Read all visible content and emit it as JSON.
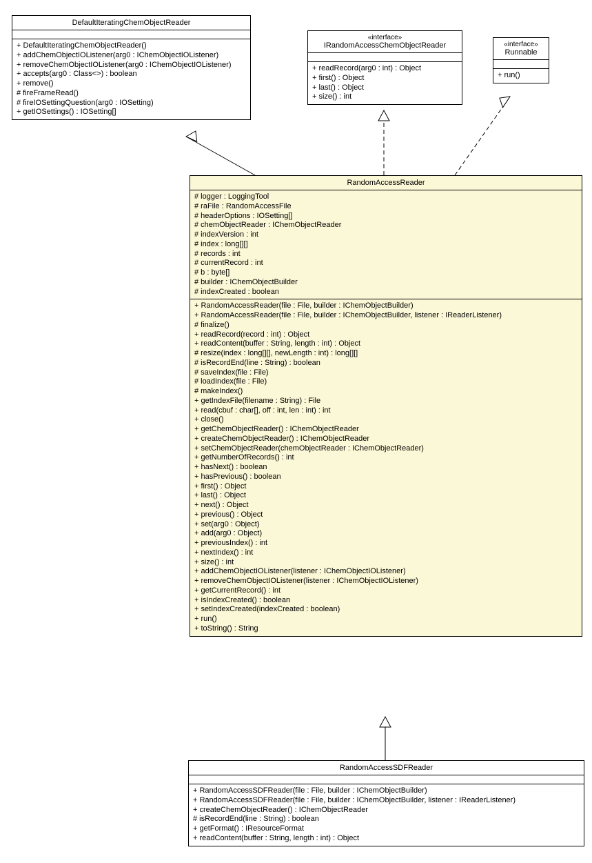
{
  "classes": {
    "dicor": {
      "name": "DefaultIteratingChemObjectReader",
      "methods": [
        "+ DefaultIteratingChemObjectReader()",
        "+ addChemObjectIOListener(arg0 : IChemObjectIOListener)",
        "+ removeChemObjectIOListener(arg0 : IChemObjectIOListener)",
        "+ accepts(arg0 : Class<>) : boolean",
        "+ remove()",
        "# fireFrameRead()",
        "# fireIOSettingQuestion(arg0 : IOSetting)",
        "+ getIOSettings() : IOSetting[]"
      ]
    },
    "iracor": {
      "stereo": "«interface»",
      "name": "IRandomAccessChemObjectReader",
      "methods": [
        "+ readRecord(arg0 : int) : Object",
        "+ first() : Object",
        "+ last() : Object",
        "+ size() : int"
      ]
    },
    "runnable": {
      "stereo": "«interface»",
      "name": "Runnable",
      "methods": [
        "+ run()"
      ]
    },
    "rar": {
      "name": "RandomAccessReader",
      "attrs": [
        "# logger : LoggingTool",
        "# raFile : RandomAccessFile",
        "# headerOptions : IOSetting[]",
        "# chemObjectReader : IChemObjectReader",
        "# indexVersion : int",
        "# index : long[][]",
        "# records : int",
        "# currentRecord : int",
        "# b : byte[]",
        "# builder : IChemObjectBuilder",
        "# indexCreated : boolean"
      ],
      "methods": [
        "+ RandomAccessReader(file : File, builder : IChemObjectBuilder)",
        "+ RandomAccessReader(file : File, builder : IChemObjectBuilder, listener : IReaderListener)",
        "# finalize()",
        "+ readRecord(record : int) : Object",
        "+ readContent(buffer : String, length : int) : Object",
        "# resize(index : long[][], newLength : int) : long[][]",
        "# isRecordEnd(line : String) : boolean",
        "# saveIndex(file : File)",
        "# loadIndex(file : File)",
        "# makeIndex()",
        "+ getIndexFile(filename : String) : File",
        "+ read(cbuf : char[], off : int, len : int) : int",
        "+ close()",
        "+ getChemObjectReader() : IChemObjectReader",
        "+ createChemObjectReader() : IChemObjectReader",
        "+ setChemObjectReader(chemObjectReader : IChemObjectReader)",
        "+ getNumberOfRecords() : int",
        "+ hasNext() : boolean",
        "+ hasPrevious() : boolean",
        "+ first() : Object",
        "+ last() : Object",
        "+ next() : Object",
        "+ previous() : Object",
        "+ set(arg0 : Object)",
        "+ add(arg0 : Object)",
        "+ previousIndex() : int",
        "+ nextIndex() : int",
        "+ size() : int",
        "+ addChemObjectIOListener(listener : IChemObjectIOListener)",
        "+ removeChemObjectIOListener(listener : IChemObjectIOListener)",
        "+ getCurrentRecord() : int",
        "+ isIndexCreated() : boolean",
        "+ setIndexCreated(indexCreated : boolean)",
        "+ run()",
        "+ toString() : String"
      ]
    },
    "rasdf": {
      "name": "RandomAccessSDFReader",
      "methods": [
        "+ RandomAccessSDFReader(file : File, builder : IChemObjectBuilder)",
        "+ RandomAccessSDFReader(file : File, builder : IChemObjectBuilder, listener : IReaderListener)",
        "+ createChemObjectReader() : IChemObjectReader",
        "# isRecordEnd(line : String) : boolean",
        "+ getFormat() : IResourceFormat",
        "+ readContent(buffer : String, length : int) : Object"
      ]
    }
  }
}
